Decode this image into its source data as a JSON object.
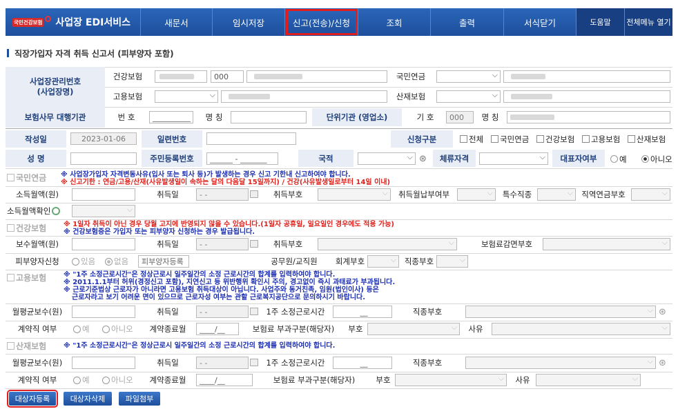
{
  "brand": {
    "badge": "국민건강보험",
    "title": "사업장 EDI서비스"
  },
  "nav": [
    "새문서",
    "임시저장",
    "신고(전송)/신청",
    "조회",
    "출력",
    "서식닫기",
    "도움말",
    "전체메뉴 열기"
  ],
  "page_title": "직장가입자 자격 취득 신고서 (피부양자 포함)",
  "biz": {
    "label": "사업장관리번호\n(사업장명)",
    "health": "건강보험",
    "employ": "고용보험",
    "pension": "국민연금",
    "injury": "산재보험",
    "code": "000"
  },
  "agent": {
    "label": "보험사무 대행기관",
    "num_label": "번 호",
    "num_value": "__________",
    "name_label": "명 칭",
    "unit_label": "단위기관 (영업소)",
    "sign_label": "기 호",
    "sign_value": "000",
    "name2_label": "명 칭"
  },
  "form": {
    "date_label": "작성일",
    "date_value": "2023-01-06",
    "serial_label": "일련번호",
    "apply_label": "신청구분",
    "apply_opts": [
      "전체",
      "국민연금",
      "건강보험",
      "고용보험",
      "산재보험"
    ],
    "name_label": "성 명",
    "rrn_label": "주민등록번호",
    "rrn_value": "______ - _______",
    "nation_label": "국적",
    "stay_label": "체류자격",
    "rep_label": "대표자여부",
    "rep_yes": "예",
    "rep_no": "아니오"
  },
  "pension": {
    "title": "국민연금",
    "note1": "※ 사업장가입자 자격변동사유(입사 또는 퇴사 등)가 발생하는 경우 신고 기한내 신고하여야 합니다.",
    "note2": "※ 신고기한 : 연금/고용/산재(사유발생일이 속하는 달의 다음달 15일까지) / 건강(사유발생일로부터 14일 이내)",
    "income": "소득월액(원)",
    "acq_date": "취득일",
    "date_ph": "-   -",
    "acq_code": "취득부호",
    "monthly": "취득월납부여부",
    "special": "특수직종",
    "job_pension": "직역연금부호",
    "confirm": "소득월액확인"
  },
  "health": {
    "title": "건강보험",
    "note1": "※ 1일자 취득이 아닌 경우 당월 고지에 반영되지 않을 수 있습니다.(1일자 공휴일, 일요일인 경우에도 적용 가능)",
    "note2": "※ 건강보험증은 가입자 또는 피부양자 신청하는 경우 발급됩니다.",
    "pay": "보수월액(원)",
    "acq_date": "취득일",
    "acq_code": "취득부호",
    "reduce": "보험료감면부호",
    "dep": "피부양자신청",
    "yes": "있음",
    "no": "없음",
    "dep_btn": "피부양자등록",
    "civil": "공무원/교직원",
    "acct": "회계부호",
    "job": "직종부호"
  },
  "employ": {
    "title": "고용보험",
    "note1": "※ \"1주 소정근로시간\"은 정상근로시 일주일간의 소정 근로시간의 합계를 입력하여야 합니다.",
    "note2": "※ 2011.1.1부터 허위(경정신고 포함), 지연신고 등 위반행위 확인시 주의, 경고없이 즉시 과태료가 부과됩니다.",
    "note3": "※ 근로기준법상 근로자가 아니라면 고용보험 취득대상이 아닙니다. 사업주와 동거친족, 임원(법인이사) 등은",
    "note4": "근로자라고 보기 어려운 면이 있으므로 근로자성 여부는 관할 근로복지공단으로 문의하시기 바랍니다.",
    "avg": "월평균보수(원)",
    "acq_date": "취득일",
    "hours": "1주 소정근로시간",
    "hours_ph": "__",
    "job": "직종부호",
    "contract": "계약직 여부",
    "yes": "예",
    "no": "아니오",
    "end": "계약종료월",
    "end_ph": "____/__",
    "levy": "보험료 부과구분(해당자)",
    "code": "부호",
    "reason": "사유"
  },
  "injury": {
    "title": "산재보험",
    "note1": "※ \"1주 소정근로시간\"은 정상근로시 일주일간의 소정 근로시간의 합계를 입력하여야 합니다.",
    "avg": "월평균보수(원)",
    "acq_date": "취득일",
    "hours": "1주 소정근로시간",
    "hours_ph": "__",
    "job": "직종부호",
    "contract": "계약직 여부",
    "yes": "예",
    "no": "아니오",
    "end": "계약종료월",
    "end_ph": "____/__",
    "levy": "보험료 부과구분(해당자)",
    "code": "부호",
    "reason": "사유"
  },
  "buttons": [
    "대상자등록",
    "대상자삭제",
    "파일첨부"
  ],
  "colors": {
    "nav_bg": "#1e4f9c",
    "label_bg": "#e9edf5",
    "highlight": "#e31d1d",
    "notice_blue": "#1c2fb0",
    "notice_red": "#e0201a"
  }
}
